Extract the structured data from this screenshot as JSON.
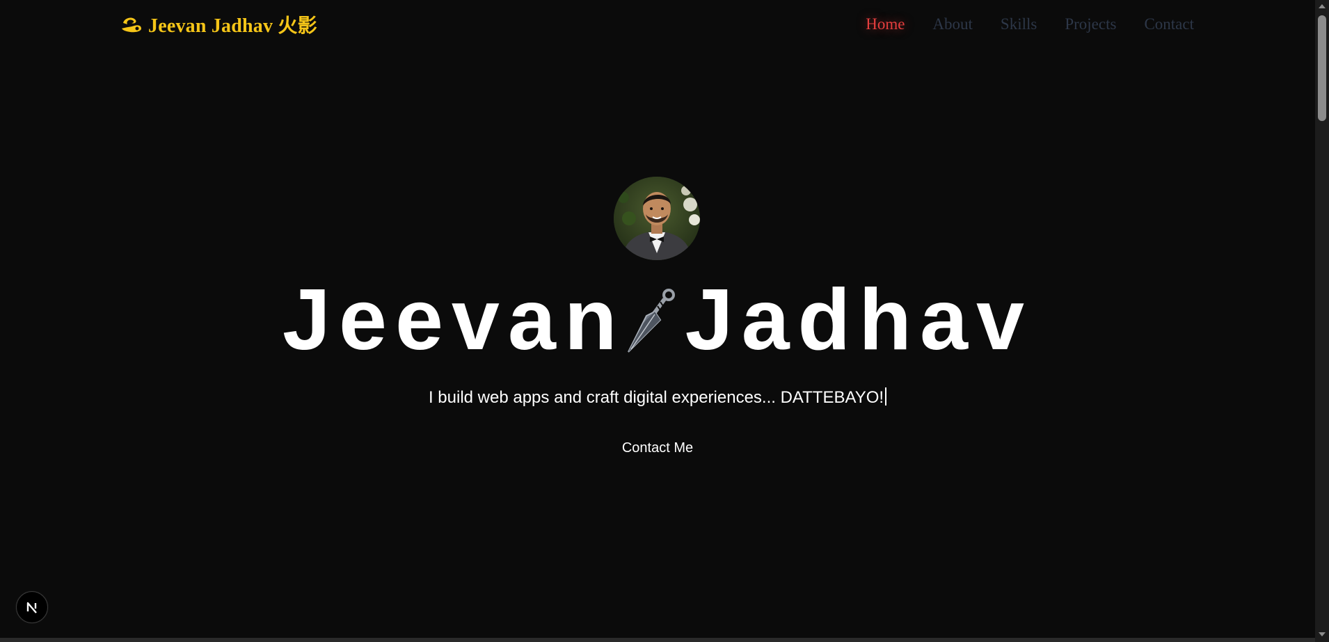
{
  "navbar": {
    "logo_text": "Jeevan Jadhav 火影",
    "logo_icon": "swirl-icon",
    "links": [
      {
        "label": "Home",
        "active": true
      },
      {
        "label": "About",
        "active": false
      },
      {
        "label": "Skills",
        "active": false
      },
      {
        "label": "Projects",
        "active": false
      },
      {
        "label": "Contact",
        "active": false
      }
    ]
  },
  "hero": {
    "title_first": "Jeevan",
    "title_last": "Jadhav",
    "title_icon": "kunai-icon",
    "tagline": "I build web apps and craft digital experiences... DATTEBAYO!",
    "cta_label": "Contact Me"
  },
  "dev_badge": {
    "letter": "N"
  },
  "colors": {
    "background": "#0b0b0b",
    "logo": "#f5c518",
    "nav_active": "#e53e3e",
    "nav_inactive": "#2d3748",
    "text": "#ffffff"
  }
}
